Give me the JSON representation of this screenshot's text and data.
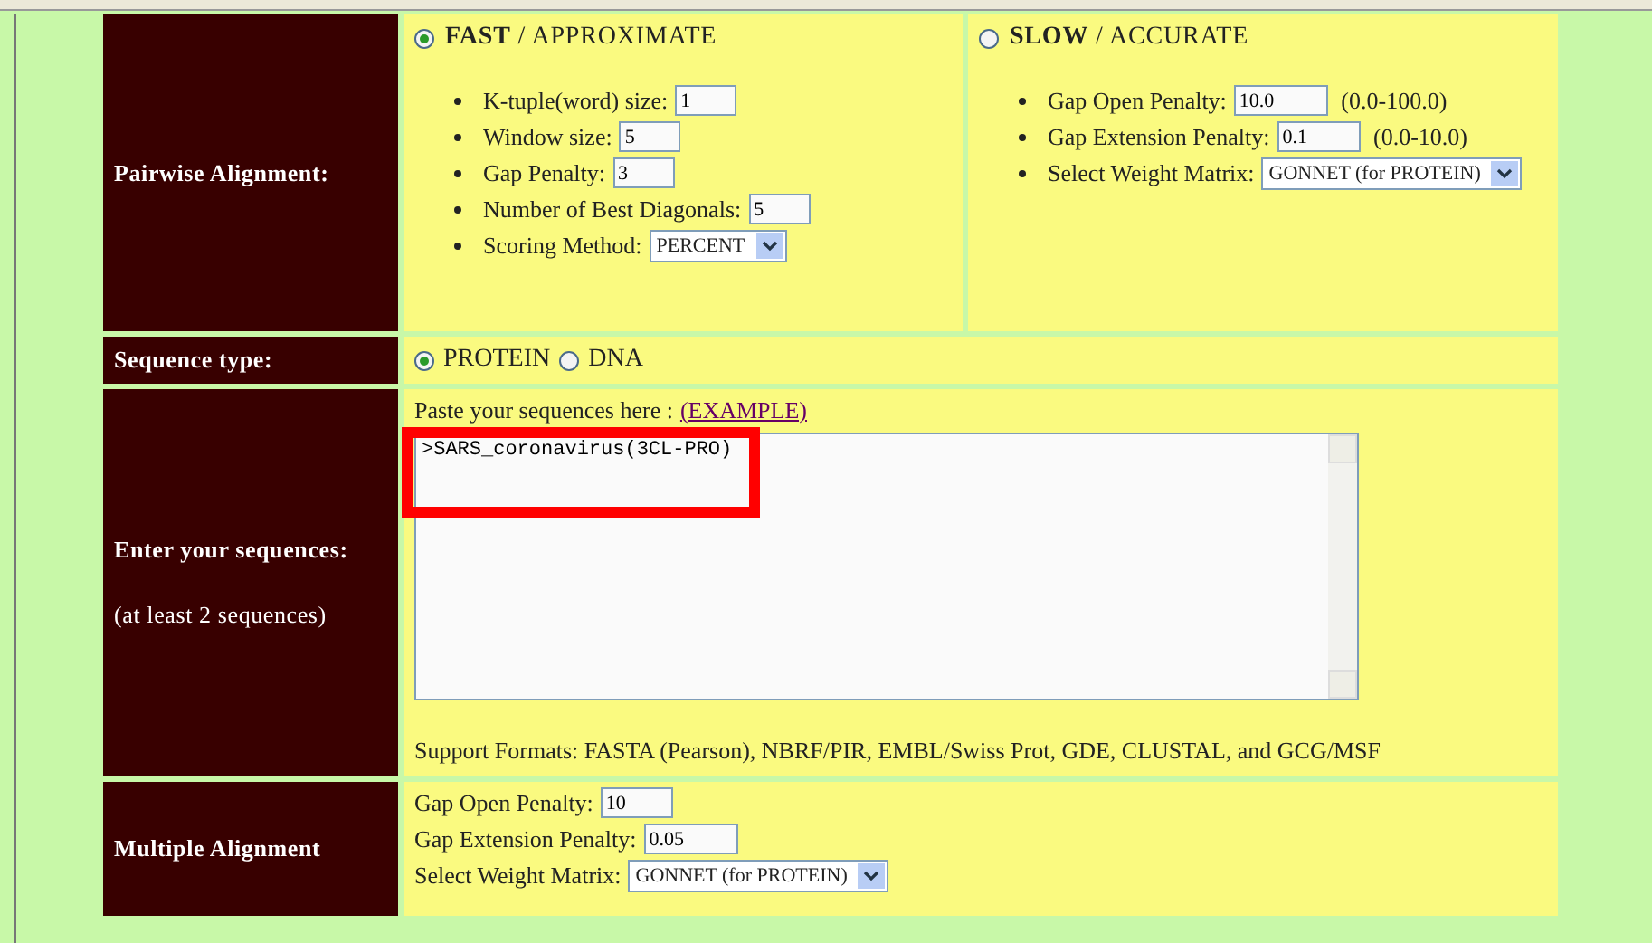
{
  "pairwise_alignment": {
    "label": "Pairwise Alignment:",
    "modes": [
      {
        "name": "FAST",
        "separator": "/",
        "detail": "APPROXIMATE",
        "selected": true,
        "params": [
          {
            "kind": "input",
            "label": "K-tuple(word) size:",
            "value": "1"
          },
          {
            "kind": "input",
            "label": "Window size:",
            "value": "5"
          },
          {
            "kind": "input",
            "label": "Gap Penalty:",
            "value": "3"
          },
          {
            "kind": "input",
            "label": "Number of Best Diagonals:",
            "value": "5"
          },
          {
            "kind": "select",
            "label": "Scoring Method:",
            "value": "PERCENT"
          }
        ]
      },
      {
        "name": "SLOW",
        "separator": "/",
        "detail": "ACCURATE",
        "selected": false,
        "params": [
          {
            "kind": "input",
            "label": "Gap Open Penalty:",
            "value": "10.0",
            "range": "(0.0-100.0)"
          },
          {
            "kind": "input",
            "label": "Gap Extension Penalty:",
            "value": "0.1",
            "range": "(0.0-10.0)"
          },
          {
            "kind": "select",
            "label": "Select Weight Matrix:",
            "value": "GONNET (for PROTEIN)"
          }
        ]
      }
    ]
  },
  "sequence_type": {
    "label": "Sequence type:",
    "options": [
      {
        "label": "PROTEIN",
        "selected": true
      },
      {
        "label": "DNA",
        "selected": false
      }
    ]
  },
  "sequences": {
    "label": "Enter your sequences:",
    "note": "(at least 2 sequences)",
    "prompt": "Paste your sequences here :",
    "example_link": "(EXAMPLE)",
    "value": ">SARS_coronavirus(3CL-PRO)",
    "highlighted": true,
    "formats": "Support Formats: FASTA (Pearson), NBRF/PIR, EMBL/Swiss Prot, GDE, CLUSTAL, and GCG/MSF"
  },
  "multiple_alignment": {
    "label": "Multiple Alignment",
    "params": [
      {
        "kind": "input",
        "label": "Gap Open Penalty:",
        "value": "10"
      },
      {
        "kind": "input",
        "label": "Gap Extension Penalty:",
        "value": "0.05"
      },
      {
        "kind": "select",
        "label": "Select Weight Matrix:",
        "value": "GONNET (for PROTEIN)"
      }
    ]
  }
}
